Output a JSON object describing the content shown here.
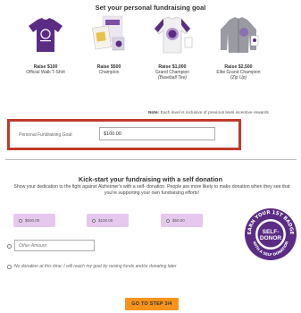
{
  "goal_section": {
    "title": "Set your personal fundraising goal",
    "levels": [
      {
        "raise": "Raise $100",
        "name": "Official Walk T-Shirt",
        "sub": ""
      },
      {
        "raise": "Raise $500",
        "name": "Champion",
        "sub": ""
      },
      {
        "raise": "Raise $1,000",
        "name": "Grand Champion",
        "sub": "(Baseball Tee)"
      },
      {
        "raise": "Raise $2,500",
        "name": "Elite Grand Champion",
        "sub": "(Zip Up)"
      }
    ],
    "note_bold": "Note:",
    "note_text": "Each level is inclusive of previous level incentive rewards",
    "goal_label": "Personal Fundraising Goal:",
    "goal_value": "$100.00"
  },
  "self_donation": {
    "title": "Kick-start your fundraising with a self donation",
    "description": "Show your dedication to the fight against Alzheimer's with a self- donation. People are more likely to make donation when they see that you're supporting your own fundraising efforts!",
    "amounts": [
      "$500.00",
      "$100.00",
      "$50.00"
    ],
    "other_placeholder": "Other Amount",
    "no_donation_text": "No donation at this time; I will reach my goal by raising funds and/or donating later"
  },
  "badge": {
    "top_text": "EARN YOUR 1ST BADGE",
    "line1": "SELF-",
    "line2": "DONOR",
    "bottom_text": "WITH A SELF DONATION"
  },
  "colors": {
    "purple": "#5b2c83",
    "lavender": "#e6c8ef",
    "highlight_border": "#c0392b",
    "cta_orange": "#f7941d"
  },
  "cta": {
    "label": "GO TO STEP 3/4"
  }
}
